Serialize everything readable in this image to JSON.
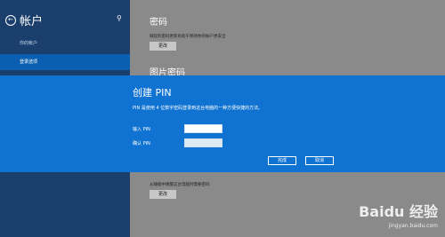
{
  "sidebar": {
    "title": "帐户",
    "items": [
      {
        "label": "你的帐户"
      },
      {
        "label": "登录选项"
      }
    ]
  },
  "sections": {
    "password": {
      "title": "密码",
      "desc": "微软的密码更新有助于保持你的帐户更安全",
      "button": "更改"
    },
    "picture_password": {
      "title": "图片密码"
    },
    "require": {
      "desc": "从睡眠中唤醒这台电脑时需要密码",
      "button": "更改"
    }
  },
  "dialog": {
    "title": "创建 PIN",
    "desc": "PIN 是使用 4 位数字密码登录到这台电脑的一种方便快捷的方法。",
    "pin_label": "输入 PIN",
    "confirm_label": "确认 PIN",
    "finish_button": "完成",
    "cancel_button": "取消"
  },
  "watermark": {
    "text": "Baidu 经验",
    "url": "jingyan.baidu.com"
  },
  "colors": {
    "sidebar": "#1b3f6d",
    "selected": "#0a5fb0",
    "dialog": "#1073d1"
  }
}
